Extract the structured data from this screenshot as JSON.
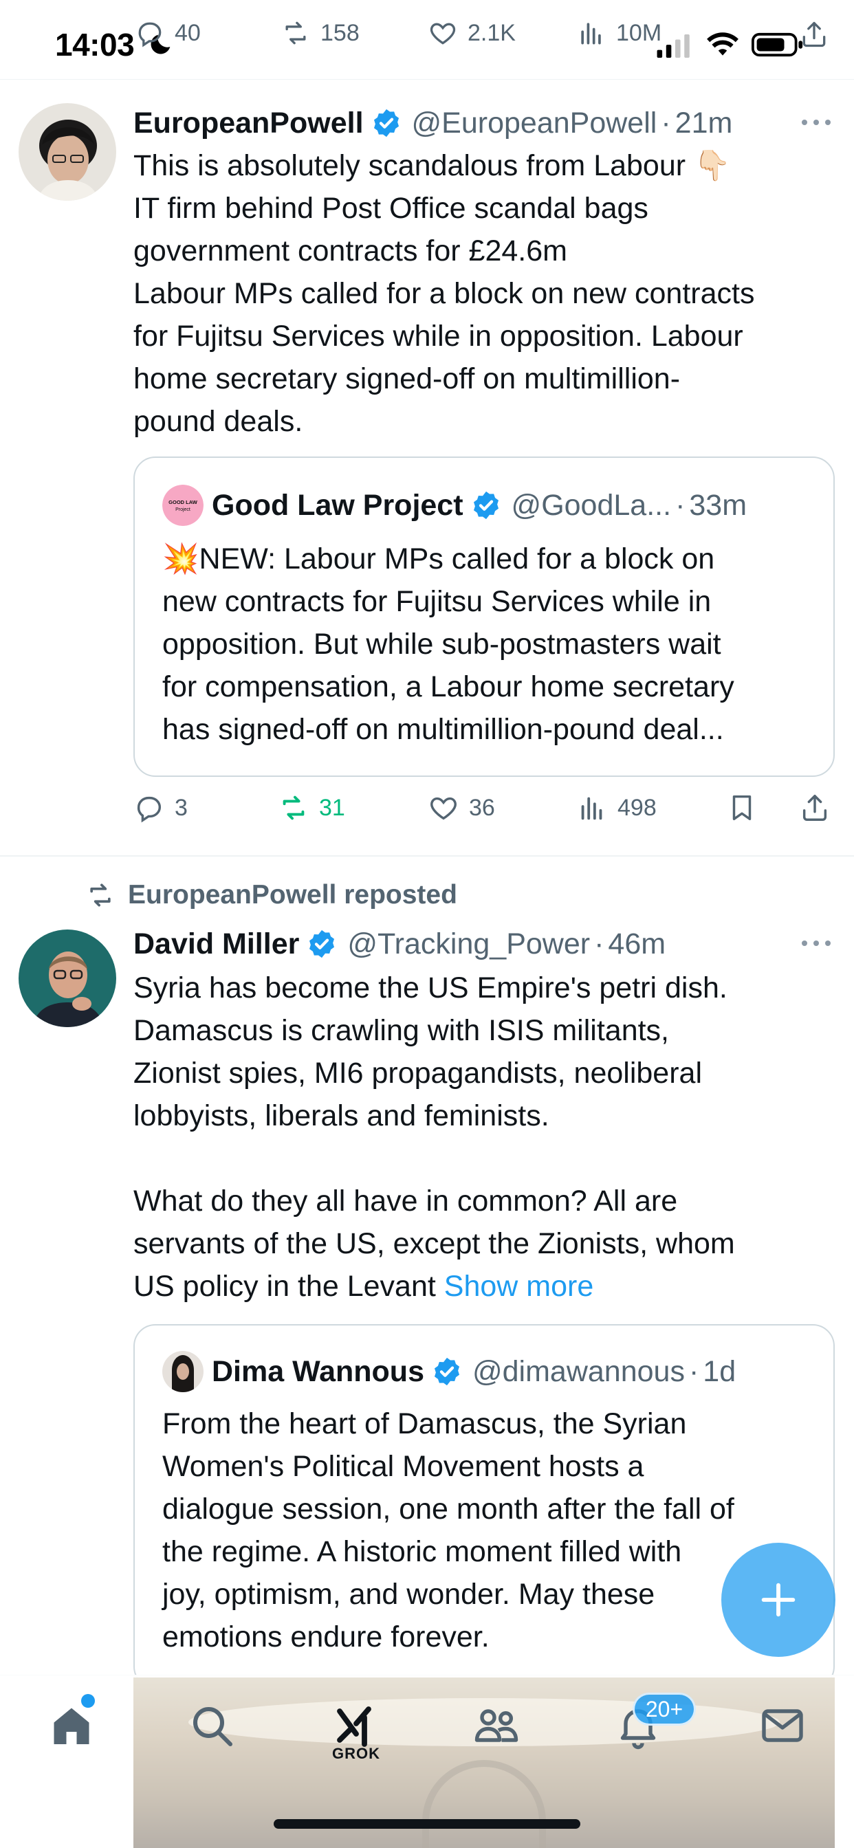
{
  "status_bar": {
    "time": "14:03",
    "stats": {
      "replies": "40",
      "reposts": "158",
      "likes": "2.1K",
      "views": "10M"
    }
  },
  "tweet1": {
    "name": "EuropeanPowell",
    "handle": "@EuropeanPowell",
    "separator": "·",
    "time": "21m",
    "text_lines": [
      "This is absolutely scandalous from Labour 👇🏻",
      "IT firm behind Post Office scandal bags",
      "government contracts for £24.6m",
      "Labour MPs called for a block on new contracts",
      "for Fujitsu Services while in opposition. Labour",
      "home secretary signed-off on multimillion-",
      "pound deals."
    ],
    "quote": {
      "name": "Good Law Project",
      "handle": "@GoodLa...",
      "separator": "·",
      "time": "33m",
      "avatar_text": "GOOD LAW Project",
      "text_lines": [
        "💥NEW: Labour MPs called for a block on",
        "new contracts for Fujitsu Services while in",
        "opposition. But while sub-postmasters wait",
        "for compensation, a Labour home secretary",
        "has signed-off on multimillion-pound deal..."
      ]
    },
    "actions": {
      "replies": "3",
      "reposts": "31",
      "likes": "36",
      "views": "498"
    }
  },
  "tweet2": {
    "reposted_by": "EuropeanPowell reposted",
    "name": "David Miller",
    "handle": "@Tracking_Power",
    "separator": "·",
    "time": "46m",
    "text_lines": [
      "Syria has become the US Empire's petri dish.",
      "Damascus is crawling with ISIS militants,",
      "Zionist spies, MI6 propagandists, neoliberal",
      "lobbyists, liberals and feminists.",
      "",
      "What do they all have in common? All are",
      "servants of the US, except the Zionists, whom"
    ],
    "last_line": "US policy in the Levant ",
    "show_more": "Show more",
    "quote": {
      "name": "Dima Wannous",
      "handle": "@dimawannous",
      "separator": "·",
      "time": "1d",
      "text_lines": [
        "From the heart of Damascus, the Syrian",
        "Women's Political Movement hosts a",
        "dialogue session, one month after the fall of",
        "the regime. A historic moment filled with",
        "joy, optimism, and wonder. May these",
        "emotions endure forever."
      ]
    }
  },
  "bottom_nav": {
    "grok_label": "GROK",
    "notifications_badge": "20+"
  },
  "colors": {
    "accent": "#1d9bf0",
    "repost_active": "#00ba7c",
    "text_primary": "#0f1419",
    "text_secondary": "#536471"
  }
}
